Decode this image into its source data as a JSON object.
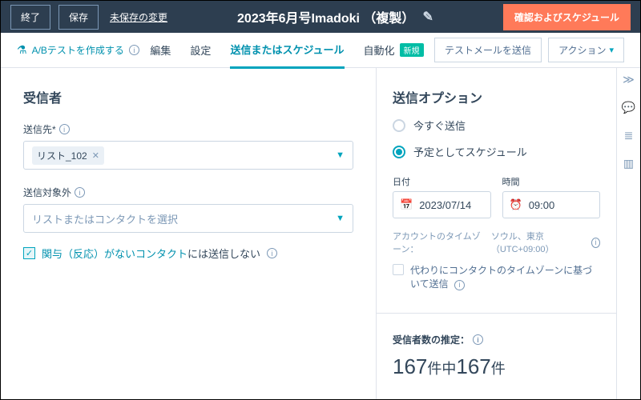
{
  "topbar": {
    "exit": "終了",
    "save": "保存",
    "unsaved": "未保存の変更",
    "title": "2023年6月号Imadoki （複製）",
    "confirm": "確認およびスケジュール"
  },
  "ab": {
    "label": "A/Bテストを作成する"
  },
  "tabs": {
    "edit": "編集",
    "settings": "設定",
    "send": "送信またはスケジュール",
    "automation": "自動化",
    "new_badge": "新規"
  },
  "actions": {
    "test_mail": "テストメールを送信",
    "actions": "アクション"
  },
  "left": {
    "recipients_h": "受信者",
    "send_to_label": "送信先*",
    "chip": "リスト_102",
    "exclude_label": "送信対象外",
    "exclude_placeholder": "リストまたはコンタクトを選択",
    "engage_prefix": "関与（反応）がないコンタクト",
    "engage_suffix": "には送信しない"
  },
  "right": {
    "options_h": "送信オプション",
    "send_now": "今すぐ送信",
    "schedule": "予定としてスケジュール",
    "date_label": "日付",
    "date_value": "2023/07/14",
    "time_label": "時間",
    "time_value": "09:00",
    "tz_prefix": "アカウントのタイムゾーン：",
    "tz_value": "ソウル、東京（UTC+09:00）",
    "use_contact_tz": "代わりにコンタクトのタイムゾーンに基づいて送信",
    "estimate_label": "受信者数の推定：",
    "est_total": "167",
    "est_unit1": "件中",
    "est_sel": "167",
    "est_unit2": "件"
  }
}
